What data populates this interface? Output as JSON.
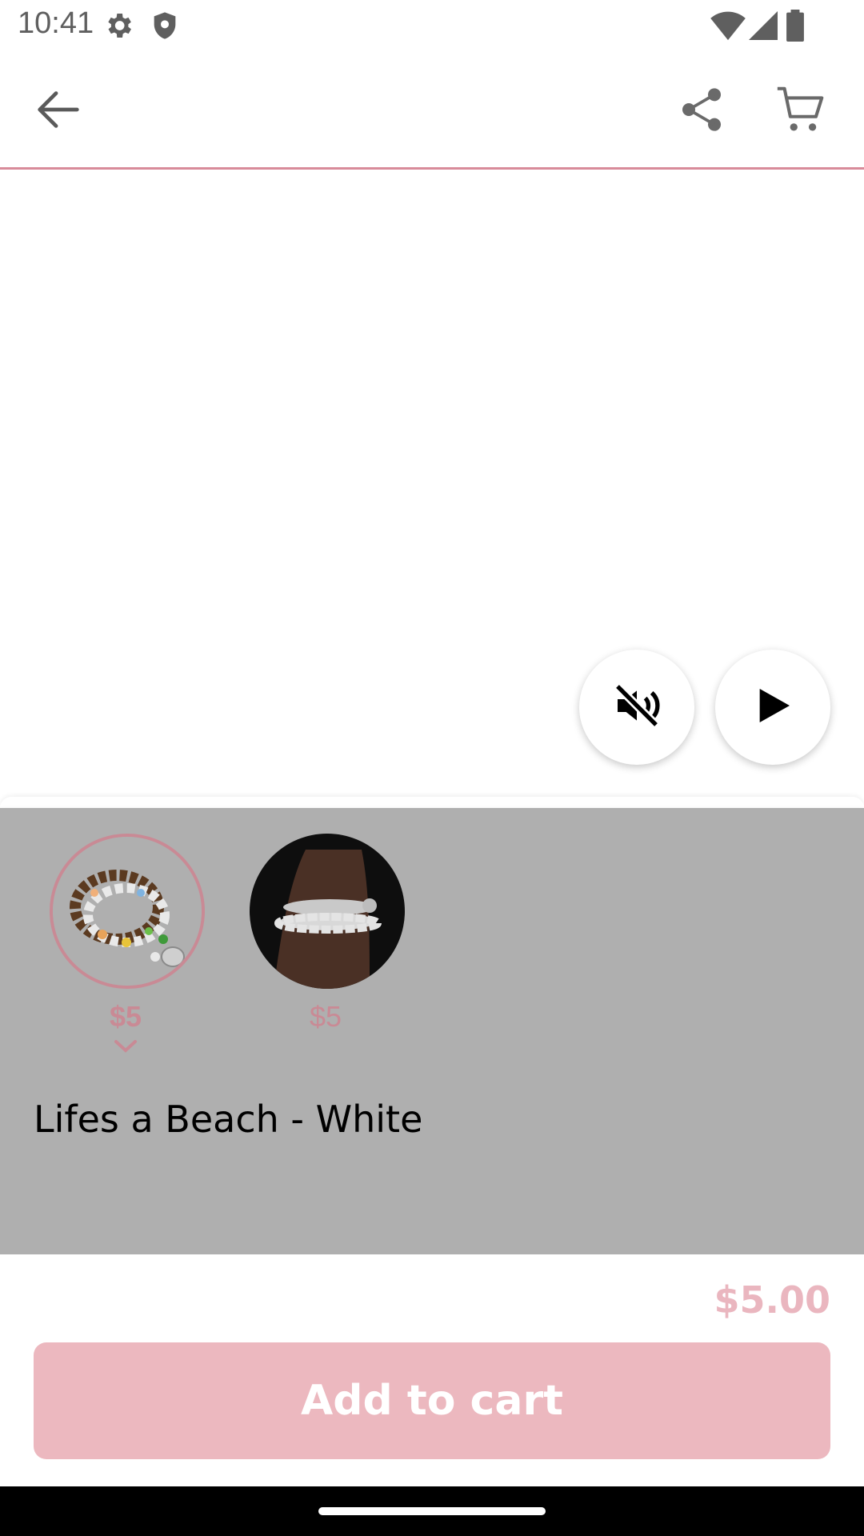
{
  "status_bar": {
    "time": "10:41",
    "icons": [
      "settings-icon",
      "shield-icon",
      "wifi-icon",
      "signal-icon",
      "battery-icon"
    ]
  },
  "app_bar": {
    "back_icon": "arrow-back-icon",
    "share_icon": "share-icon",
    "cart_icon": "cart-icon",
    "divider_color": "#d88b9a"
  },
  "media": {
    "mute_icon": "volume-off-icon",
    "play_icon": "play-icon"
  },
  "variants": [
    {
      "price": "$5",
      "selected": true
    },
    {
      "price": "$5",
      "selected": false
    }
  ],
  "product": {
    "title": "Lifes a Beach - White"
  },
  "purchase": {
    "total": "$5.00",
    "add_to_cart_label": "Add to cart",
    "accent_color": "#ecb8bf"
  }
}
